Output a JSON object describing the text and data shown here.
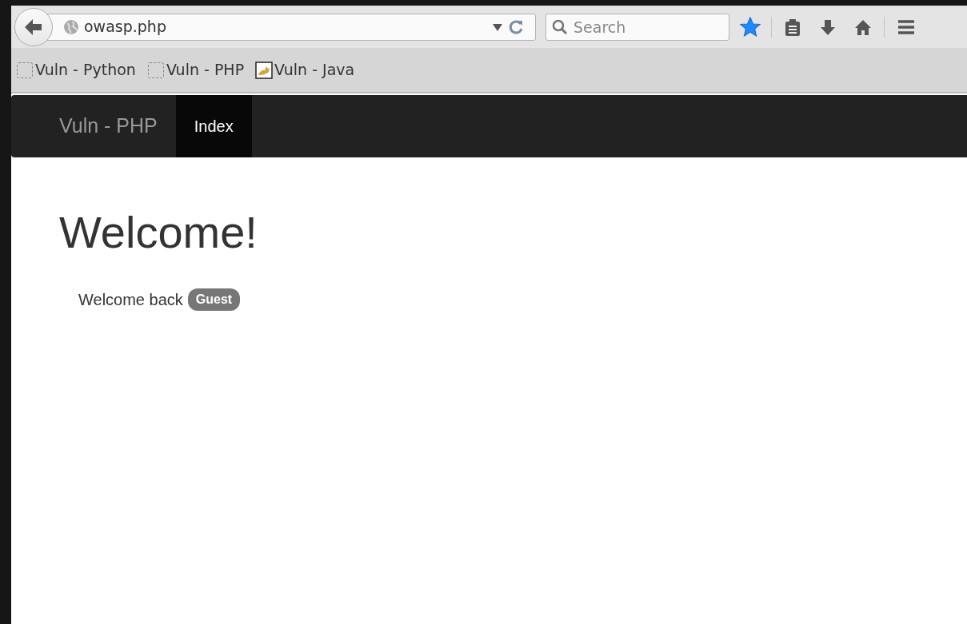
{
  "browser": {
    "url": "owasp.php",
    "search": {
      "placeholder": "Search"
    },
    "bookmark_starred": true
  },
  "bookmarks": [
    {
      "label": "Vuln - Python",
      "kind": "blank"
    },
    {
      "label": "Vuln - PHP",
      "kind": "blank"
    },
    {
      "label": "Vuln - Java",
      "kind": "image"
    }
  ],
  "navbar": {
    "brand": "Vuln - PHP",
    "items": [
      {
        "label": "Index",
        "selected": true
      }
    ]
  },
  "content": {
    "heading": "Welcome!",
    "text": "Welcome back",
    "badge": "Guest"
  }
}
